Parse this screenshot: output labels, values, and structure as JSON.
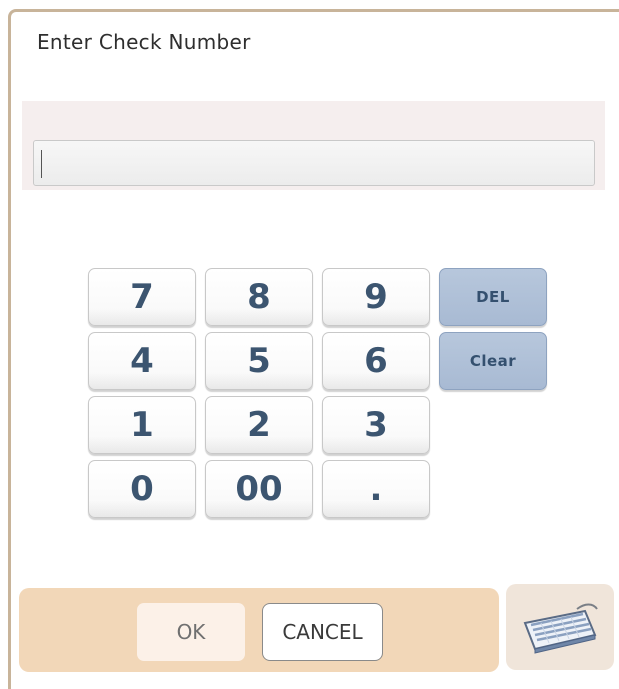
{
  "dialog": {
    "title": "Enter Check Number"
  },
  "input": {
    "value": "",
    "placeholder": ""
  },
  "keypad": {
    "keys": [
      "7",
      "8",
      "9",
      "4",
      "5",
      "6",
      "1",
      "2",
      "3",
      "0",
      "00",
      "."
    ],
    "del_label": "DEL",
    "clear_label": "Clear"
  },
  "footer": {
    "ok_label": "OK",
    "cancel_label": "CANCEL",
    "keyboard_icon": "keyboard-icon"
  },
  "colors": {
    "frame": "#c8b49a",
    "footer_bar": "#f2d7b8",
    "key_text": "#3c5570",
    "fn_key": "#a8bad3"
  }
}
